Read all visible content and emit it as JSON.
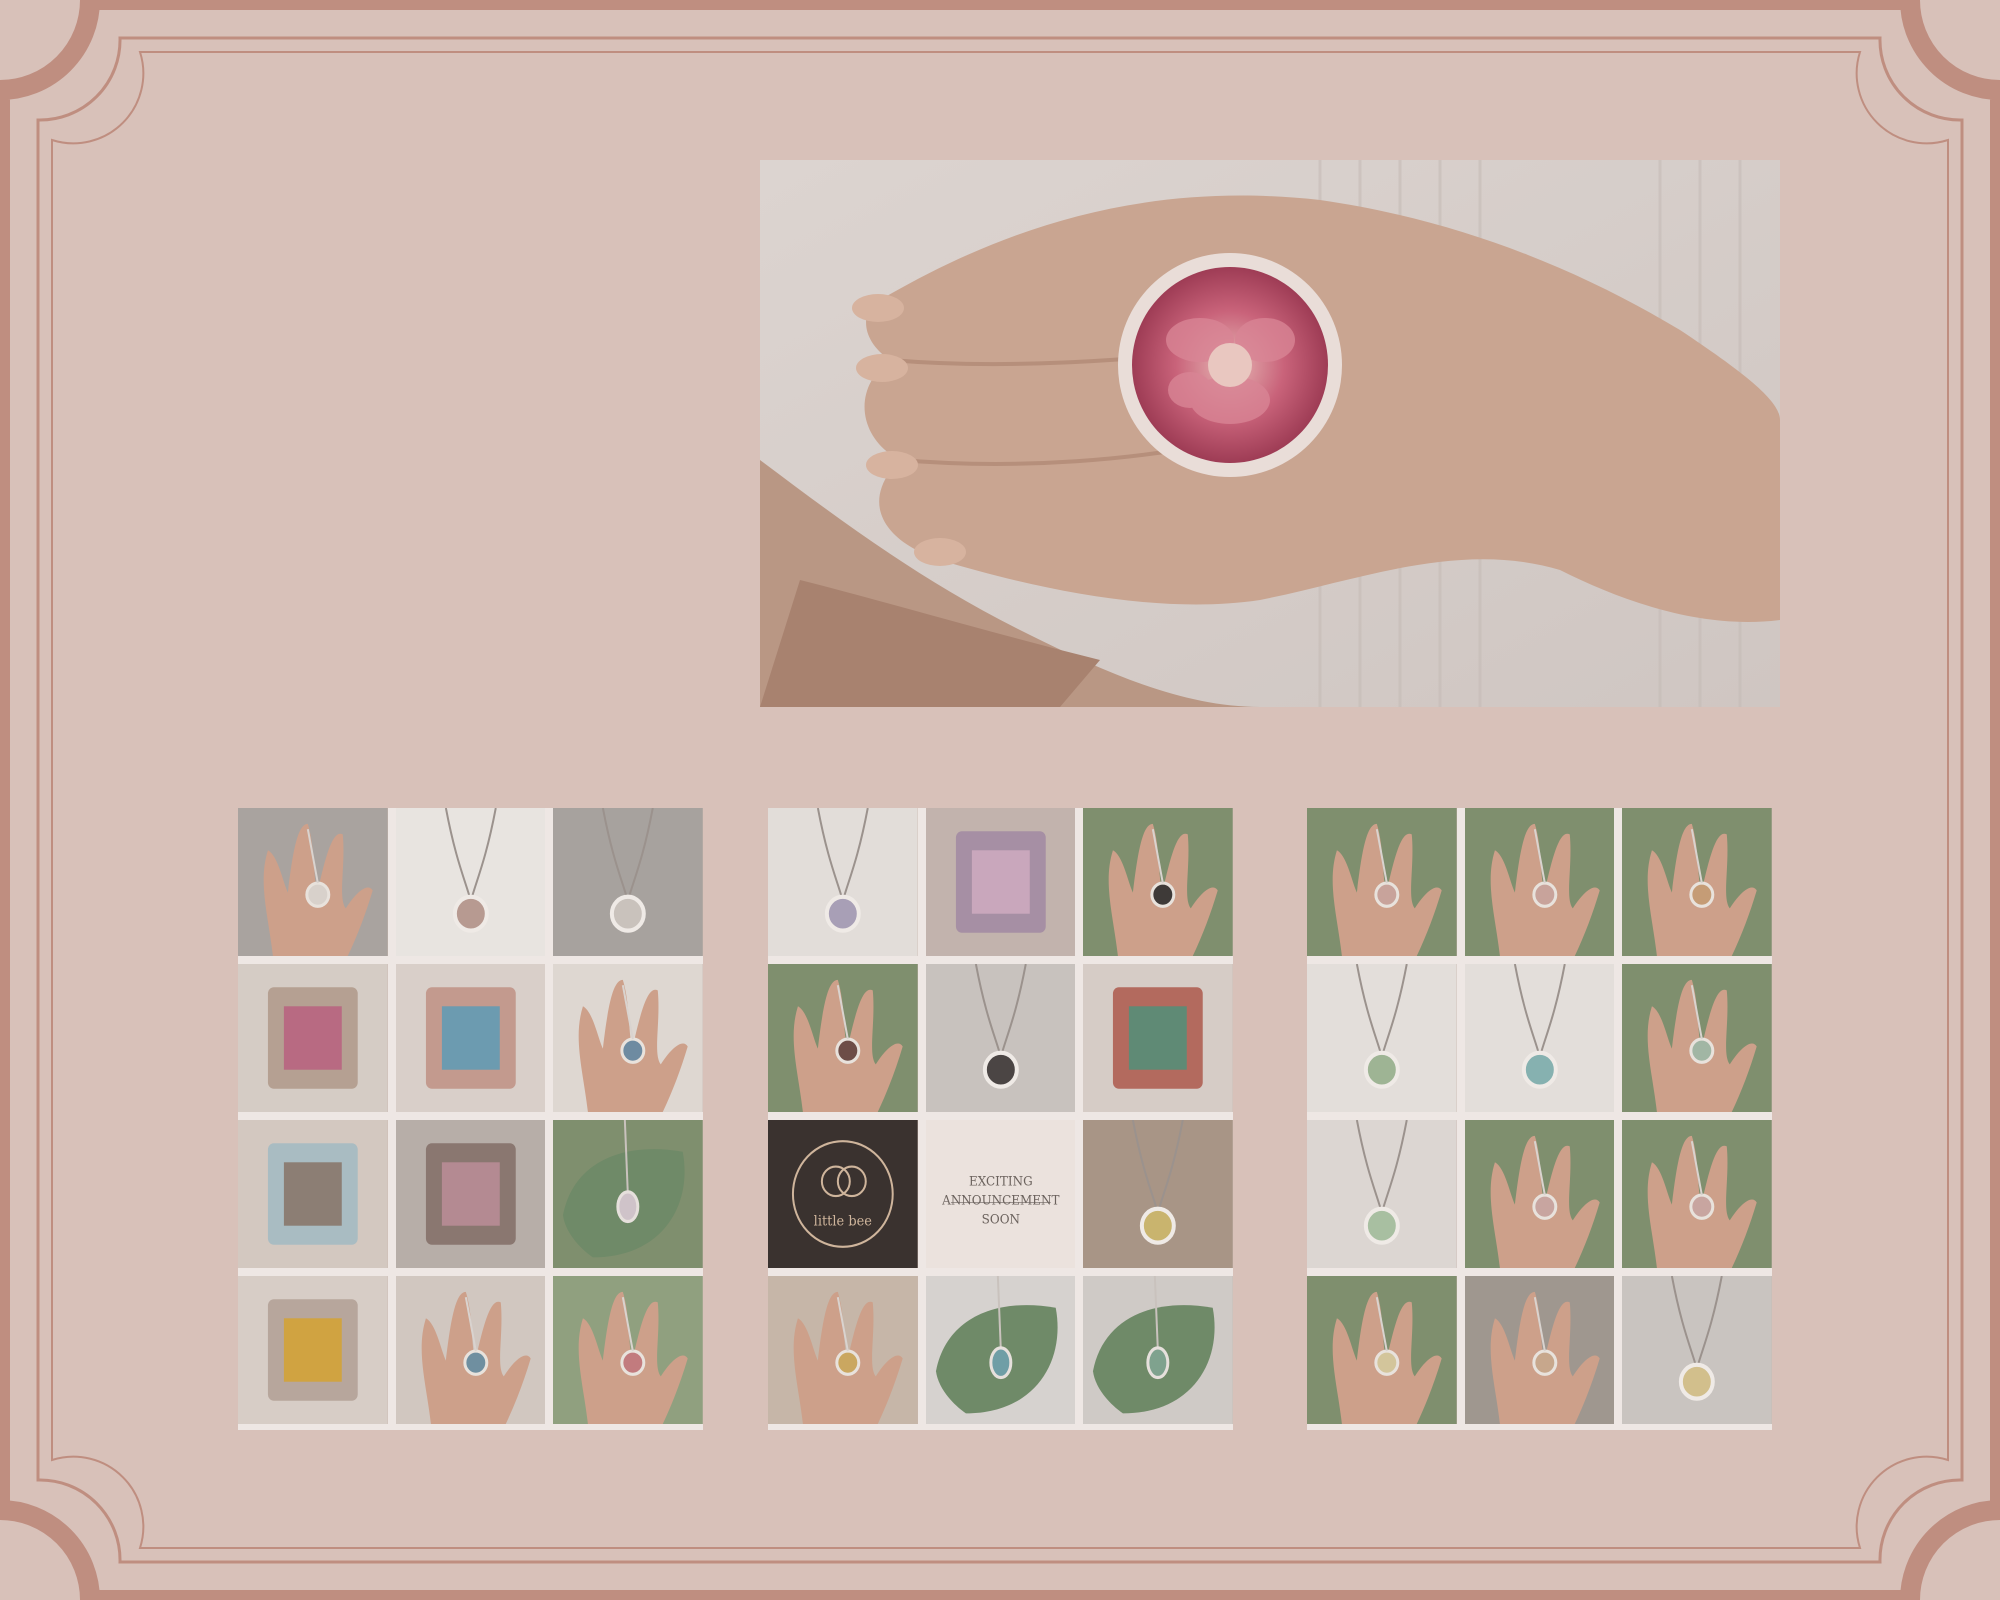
{
  "page": {
    "background": "#d8c1b9",
    "frame_color": "#bf8e80"
  },
  "hero": {
    "description_name": "pressed-rose-resin-ring-photo"
  },
  "grids": [
    {
      "name": "jewelry-grid-left"
    },
    {
      "name": "jewelry-grid-middle",
      "logo_tile": {
        "brand": "little bee"
      },
      "announcement_tile": {
        "line1": "EXCITING",
        "line2": "ANNOUNCEMENT",
        "line3": "SOON"
      }
    },
    {
      "name": "jewelry-grid-right"
    }
  ]
}
